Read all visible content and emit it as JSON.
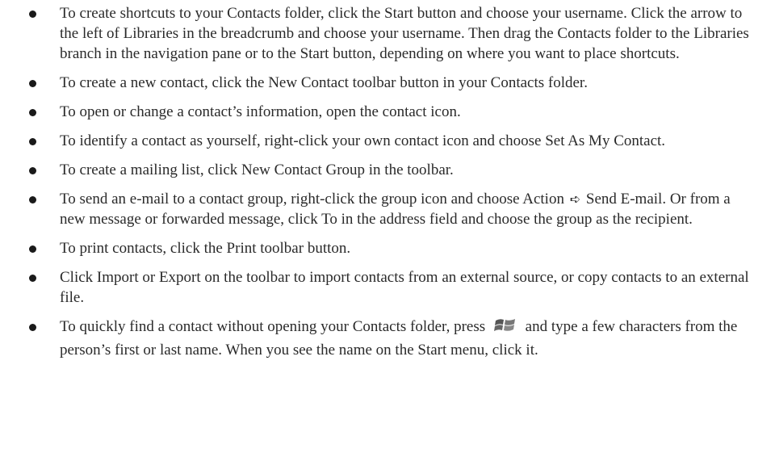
{
  "tips": [
    {
      "text": "To create shortcuts to your Contacts folder, click the Start button and choose your username. Click the arrow to the left of Libraries in the breadcrumb and choose your username. Then drag the Contacts folder to the Libraries branch in the navigation pane or to the Start button, depending on where you want to place shortcuts."
    },
    {
      "text": "To create a new contact, click the New Contact toolbar button in your Contacts folder."
    },
    {
      "text": "To open or change a contact’s information, open the contact icon."
    },
    {
      "text": "To identify a contact as yourself, right-click your own contact icon and choose Set As My Contact."
    },
    {
      "text": "To create a mailing list, click New Contact Group in the toolbar."
    },
    {
      "before": "To send an e-mail to a contact group, right-click the group icon and choose Action",
      "arrow": "➪",
      "after": "Send E-mail. Or from a new message or forwarded message, click To in the address field and choose the group as the recipient."
    },
    {
      "text": "To print contacts, click the Print toolbar button."
    },
    {
      "text": "Click Import or Export on the toolbar to import contacts from an external source, or copy contacts to an external file."
    },
    {
      "before": "To quickly find a contact without opening your Contacts folder, press",
      "icon": "windows-logo-icon",
      "after": "and type a few characters from the person’s first or last name. When you see the name on the Start menu, click it."
    }
  ],
  "colors": {
    "text": "#2a2a2a",
    "bullet": "#1a1a1a"
  }
}
